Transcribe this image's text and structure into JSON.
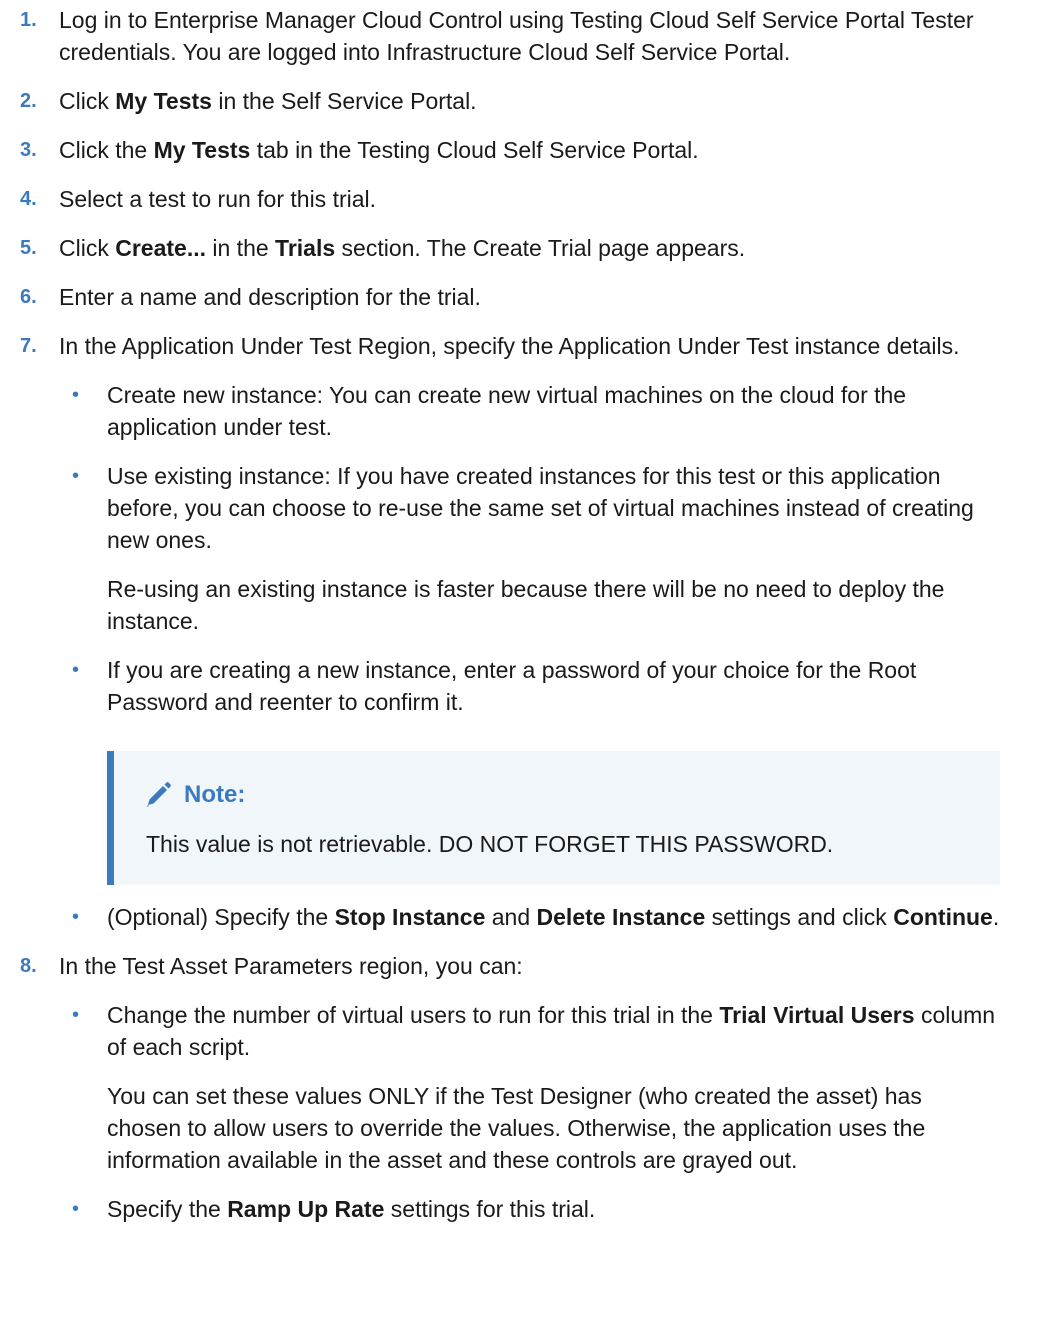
{
  "steps": [
    {
      "num": "1.",
      "text": "Log in to Enterprise Manager Cloud Control using Testing Cloud Self Service Portal Tester credentials. You are logged into Infrastructure Cloud Self Service Portal."
    },
    {
      "num": "2.",
      "pre": "Click ",
      "bold": "My Tests",
      "post": " in the Self Service Portal."
    },
    {
      "num": "3.",
      "pre": "Click the ",
      "bold": "My Tests",
      "post": " tab in the Testing Cloud Self Service Portal."
    },
    {
      "num": "4.",
      "text": "Select a test to run for this trial."
    },
    {
      "num": "5.",
      "pre": "Click ",
      "bold": "Create...",
      "mid": " in the ",
      "bold2": "Trials",
      "post": " section. The Create Trial page appears."
    },
    {
      "num": "6.",
      "text": "Enter a name and description for the trial."
    },
    {
      "num": "7.",
      "text": "In the Application Under Test Region, specify the Application Under Test instance details."
    },
    {
      "num": "8.",
      "text": "In the Test Asset Parameters region, you can:"
    }
  ],
  "step7_bullets": {
    "b1": "Create new instance: You can create new virtual machines on the cloud for the application under test.",
    "b2": "Use existing instance: If you have created instances for this test or this application before, you can choose to re-use the same set of virtual machines instead of creating new ones.",
    "b2_para": "Re-using an existing instance is faster because there will be no need to deploy the instance.",
    "b3": "If you are creating a new instance, enter a password of your choice for the Root Password and reenter to confirm it.",
    "b4_pre": "(Optional) Specify the ",
    "b4_bold1": "Stop Instance",
    "b4_mid": " and ",
    "b4_bold2": "Delete Instance",
    "b4_mid2": " settings and click ",
    "b4_bold3": "Continue",
    "b4_post": "."
  },
  "note": {
    "title": "Note:",
    "body": "This value is not retrievable. DO NOT FORGET THIS PASSWORD.",
    "icon": "pencil-icon"
  },
  "step8_bullets": {
    "b1_pre": "Change the number of virtual users to run for this trial in the ",
    "b1_bold": "Trial Virtual Users",
    "b1_post": " column of each script.",
    "b1_para": "You can set these values ONLY if the Test Designer (who created the asset) has chosen to allow users to override the values. Otherwise, the application uses the information available in the asset and these controls are grayed out.",
    "b2_pre": "Specify the ",
    "b2_bold": "Ramp Up Rate",
    "b2_post": " settings for this trial."
  },
  "bullet_char": "•",
  "colors": {
    "accent": "#3b7bbd",
    "note_bg": "#f1f6fb"
  }
}
